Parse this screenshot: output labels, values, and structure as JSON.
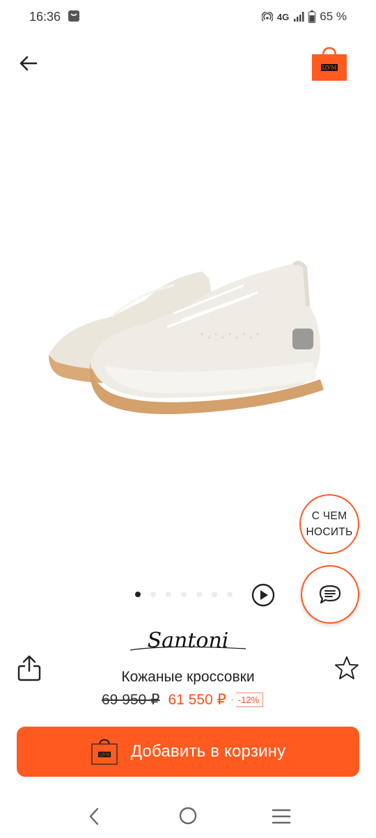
{
  "status_bar": {
    "time": "16:36",
    "network": "4G",
    "battery": "65 %"
  },
  "top_bar": {
    "back_icon": "arrow-left-icon",
    "cart_icon": "shopping-bag-icon",
    "cart_bag_text": "ЦУМ"
  },
  "product": {
    "brand": "Santoni",
    "title": "Кожаные кроссовки",
    "old_price": "69 950 ₽",
    "new_price": "61 550 ₽",
    "discount": "-12%",
    "image_count": 7,
    "active_image": 1
  },
  "floating": {
    "wear_line1": "С ЧЕМ",
    "wear_line2": "НОСИТЬ",
    "chat_icon": "chat-icon"
  },
  "cta": {
    "label": "Добавить в корзину"
  },
  "colors": {
    "accent": "#ff5a1f",
    "price_accent": "#ff4e14"
  }
}
